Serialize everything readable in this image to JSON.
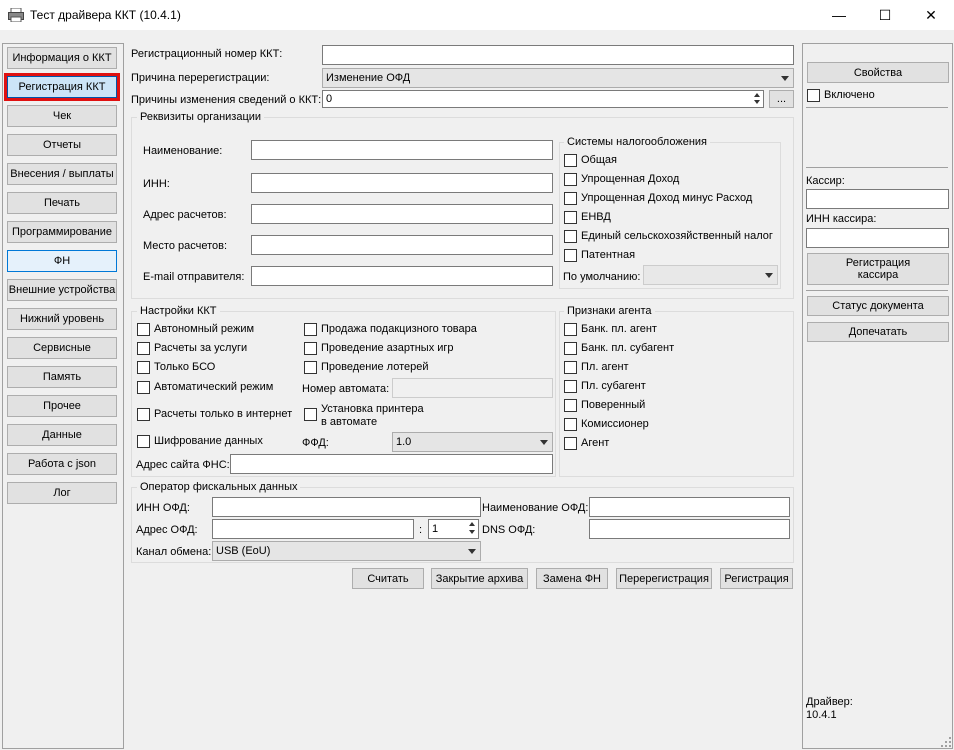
{
  "window": {
    "title": "Тест драйвера ККТ (10.4.1)",
    "minimize_glyph": "—",
    "maximize_glyph": "☐",
    "close_glyph": "✕"
  },
  "nav": [
    "Информация о ККТ",
    "Регистрация ККТ",
    "Чек",
    "Отчеты",
    "Внесения / выплаты",
    "Печать",
    "Программирование",
    "ФН",
    "Внешние устройства",
    "Нижний уровень",
    "Сервисные",
    "Память",
    "Прочее",
    "Данные",
    "Работа с json",
    "Лог"
  ],
  "top": {
    "reg_number_label": "Регистрационный номер ККТ:",
    "reg_number_value": "",
    "rereg_reason_label": "Причина перерегистрации:",
    "rereg_reason_value": "Изменение ОФД",
    "change_reasons_label": "Причины изменения сведений о ККТ:",
    "change_reasons_value": "0",
    "more_button": "..."
  },
  "org": {
    "title": "Реквизиты организации",
    "name_label": "Наименование:",
    "inn_label": "ИНН:",
    "address_label": "Адрес расчетов:",
    "place_label": "Место расчетов:",
    "email_label": "E-mail отправителя:",
    "tax": {
      "title": "Системы налогообложения",
      "items": [
        "Общая",
        "Упрощенная Доход",
        "Упрощенная Доход минус Расход",
        "ЕНВД",
        "Единый сельскохозяйственный налог",
        "Патентная"
      ],
      "default_label": "По умолчанию:"
    }
  },
  "settings": {
    "title": "Настройки ККТ",
    "left": [
      "Автономный режим",
      "Расчеты за услуги",
      "Только БСО",
      "Автоматический режим",
      "Расчеты только в интернет",
      "Шифрование данных"
    ],
    "right": [
      "Продажа подакцизного товара",
      "Проведение азартных игр",
      "Проведение лотерей"
    ],
    "automat_label": "Номер автомата:",
    "printer_label_1": "Установка принтера",
    "printer_label_2": "в автомате",
    "ffd_label": "ФФД:",
    "ffd_value": "1.0",
    "fns_site_label": "Адрес сайта ФНС:"
  },
  "agent": {
    "title": "Признаки агента",
    "items": [
      "Банк. пл. агент",
      "Банк. пл. субагент",
      "Пл. агент",
      "Пл. субагент",
      "Поверенный",
      "Комиссионер",
      "Агент"
    ]
  },
  "ofd": {
    "title": "Оператор фискальных данных",
    "inn_label": "ИНН ОФД:",
    "name_label": "Наименование ОФД:",
    "address_label": "Адрес ОФД:",
    "colon": ":",
    "port_value": "1",
    "dns_label": "DNS ОФД:",
    "channel_label": "Канал обмена:",
    "channel_value": "USB (EoU)"
  },
  "actions": [
    "Считать",
    "Закрытие архива",
    "Замена ФН",
    "Перерегистрация",
    "Регистрация"
  ],
  "right": {
    "properties": "Свойства",
    "enabled": "Включено",
    "cashier_label": "Кассир:",
    "cashier_inn_label": "ИНН кассира:",
    "register_cashier": "Регистрация кассира",
    "doc_status": "Статус документа",
    "reprint": "Допечатать",
    "driver_label": "Драйвер:",
    "driver_version": "10.4.1"
  }
}
